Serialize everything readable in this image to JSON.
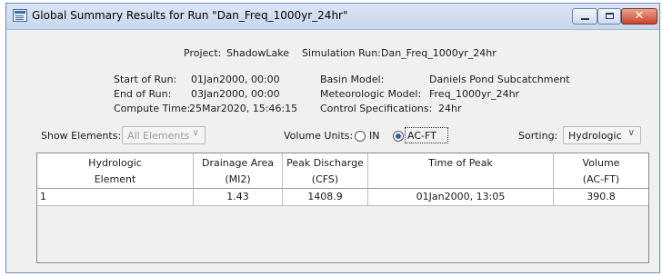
{
  "window": {
    "title": "Global Summary Results for Run \"Dan_Freq_1000yr_24hr\"",
    "icon": "hec-hms-app-icon",
    "controls": {
      "minimize": "minimize-icon",
      "maximize": "maximize-icon",
      "close_glyph": "✕"
    }
  },
  "summary": {
    "project_label": "Project:",
    "project_value": "ShadowLake",
    "simulation_run_label": "Simulation Run:",
    "simulation_run_value": "Dan_Freq_1000yr_24hr",
    "start_label": "Start of Run:",
    "start_value": "01Jan2000, 00:00",
    "end_label": "End of Run:",
    "end_value": "03Jan2000, 00:00",
    "compute_label": "Compute Time:",
    "compute_value": "25Mar2020, 15:46:15",
    "basin_label": "Basin Model:",
    "basin_value": "Daniels Pond Subcatchment",
    "met_label": "Meteorologic Model:",
    "met_value": "Freq_1000yr_24hr",
    "control_label": "Control Specifications:",
    "control_value": "24hr"
  },
  "options": {
    "show_elements_label": "Show Elements:",
    "show_elements_value": "All Elements",
    "volume_units_label": "Volume Units:",
    "unit_in": "IN",
    "unit_acft": "AC-FT",
    "selected_unit": "AC-FT",
    "sorting_label": "Sorting:",
    "sorting_value": "Hydrologic"
  },
  "table": {
    "columns": [
      {
        "line1": "Hydrologic",
        "line2": "Element"
      },
      {
        "line1": "Drainage Area",
        "line2": "(MI2)"
      },
      {
        "line1": "Peak Discharge",
        "line2": "(CFS)"
      },
      {
        "line1": "Time of Peak",
        "line2": ""
      },
      {
        "line1": "Volume",
        "line2": "(AC-FT)"
      }
    ],
    "rows": [
      {
        "element": "1",
        "area": "1.43",
        "peak": "1408.9",
        "time": "01Jan2000, 13:05",
        "volume": "390.8"
      }
    ]
  }
}
